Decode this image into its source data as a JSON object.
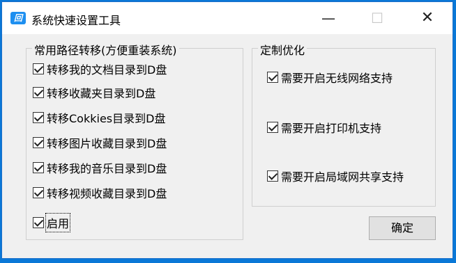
{
  "window": {
    "title": "系统快速设置工具",
    "icon_glyph": "回",
    "controls": {
      "minimize": "—",
      "maximize": "☐",
      "close": "✕"
    }
  },
  "group_paths": {
    "title": "常用路径转移(方便重装系统)",
    "items": [
      {
        "label": "转移我的文档目录到D盘",
        "checked": true
      },
      {
        "label": "转移收藏夹目录到D盘",
        "checked": true
      },
      {
        "label": "转移Cokkies目录到D盘",
        "checked": true
      },
      {
        "label": "转移图片收藏目录到D盘",
        "checked": true
      },
      {
        "label": "转移我的音乐目录到D盘",
        "checked": true
      },
      {
        "label": "转移视频收藏目录到D盘",
        "checked": true
      }
    ],
    "enable": {
      "label": "启用",
      "checked": true
    }
  },
  "group_custom": {
    "title": "定制优化",
    "items": [
      {
        "label": "需要开启无线网络支持",
        "checked": true
      },
      {
        "label": "需要开启打印机支持",
        "checked": true
      },
      {
        "label": "需要开启局域网共享支持",
        "checked": true
      }
    ]
  },
  "buttons": {
    "ok": "确定"
  },
  "colors": {
    "accent": "#0a78d7",
    "window_bg": "#f0f0f0",
    "button_bg": "#e1e1e1"
  }
}
